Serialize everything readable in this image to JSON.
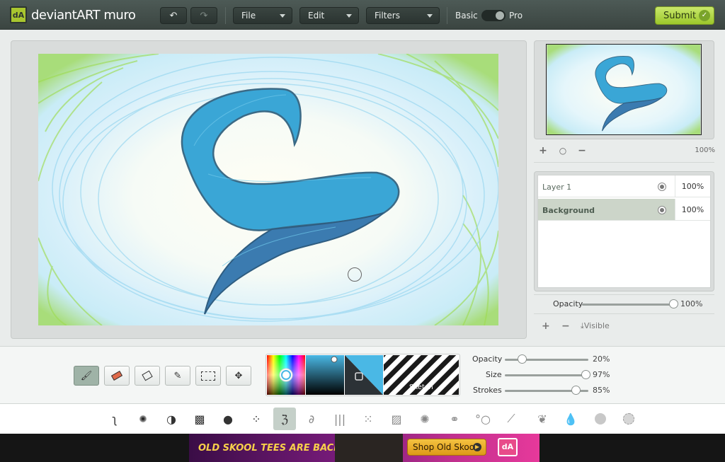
{
  "app": {
    "logo_text": "deviantART muro"
  },
  "toolbar": {
    "undo_icon": "undo-icon",
    "redo_icon": "redo-icon",
    "menus": [
      "File",
      "Edit",
      "Filters"
    ],
    "mode_basic": "Basic",
    "mode_pro": "Pro",
    "submit_label": "Submit"
  },
  "navigator": {
    "zoom_percent": "100%"
  },
  "layers": {
    "items": [
      {
        "name": "Layer 1",
        "opacity": "100%"
      },
      {
        "name": "Background",
        "opacity": "100%"
      }
    ],
    "opacity_label": "Opacity",
    "opacity_value": "100%",
    "opacity_level": 1.0,
    "visible_label": "Visible"
  },
  "tools": [
    "brush-tool-icon",
    "eraser-tool-icon",
    "smudge-tool-icon",
    "eyedropper-tool-icon",
    "selection-tool-icon",
    "move-tool-icon"
  ],
  "color": {
    "current": "#4ab8e5",
    "picker_tag": "Sketch"
  },
  "brush_settings": [
    {
      "label": "Opacity",
      "value": "20%",
      "level": 0.2
    },
    {
      "label": "Size",
      "value": "97%",
      "level": 0.97
    },
    {
      "label": "Strokes",
      "value": "85%",
      "level": 0.85
    }
  ],
  "brushes": [
    "squiggle-brush-icon",
    "soft-brush-icon",
    "shading-brush-icon",
    "crosshatch-brush-icon",
    "drip-brush-icon",
    "splatter-brush-icon",
    "sketch-brush-icon",
    "curly-brush-icon",
    "lines-brush-icon",
    "dots-brush-icon",
    "hatch-brush-icon",
    "burst-brush-icon",
    "chain-brush-icon",
    "bubbles-brush-icon",
    "feather-brush-icon",
    "leaves-brush-icon",
    "water-drop-brush-icon",
    "texture-brush-icon",
    "rough-brush-icon"
  ],
  "ad": {
    "headline": "OLD SKOOL TEES ARE BACK!",
    "button": "Shop Old Skool",
    "logo": "dA"
  }
}
